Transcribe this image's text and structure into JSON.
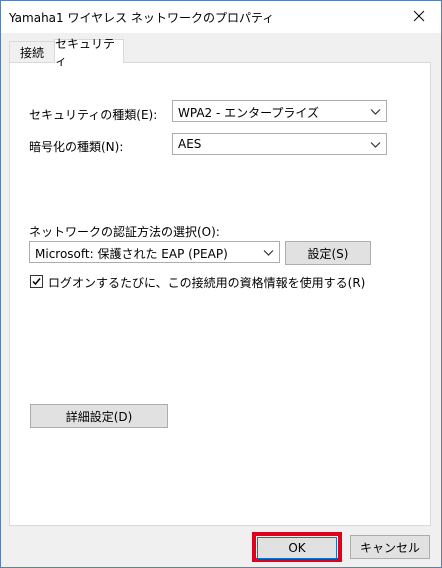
{
  "window": {
    "title": "Yamaha1 ワイヤレス ネットワークのプロパティ"
  },
  "tabs": [
    {
      "label": "接続",
      "active": false
    },
    {
      "label": "セキュリティ",
      "active": true
    }
  ],
  "security": {
    "type_label": "セキュリティの種類(E):",
    "type_value": "WPA2 - エンタープライズ",
    "encryption_label": "暗号化の種類(N):",
    "encryption_value": "AES",
    "auth_method_label": "ネットワークの認証方法の選択(O):",
    "auth_method_value": "Microsoft: 保護された EAP (PEAP)",
    "settings_button": "設定(S)",
    "remember_checkbox_label": "ログオンするたびに、この接続用の資格情報を使用する(R)",
    "remember_checked": true,
    "advanced_button": "詳細設定(D)"
  },
  "footer": {
    "ok_label": "OK",
    "cancel_label": "キャンセル"
  },
  "colors": {
    "highlight": "#e0001b",
    "focus_border": "#0078d7"
  }
}
